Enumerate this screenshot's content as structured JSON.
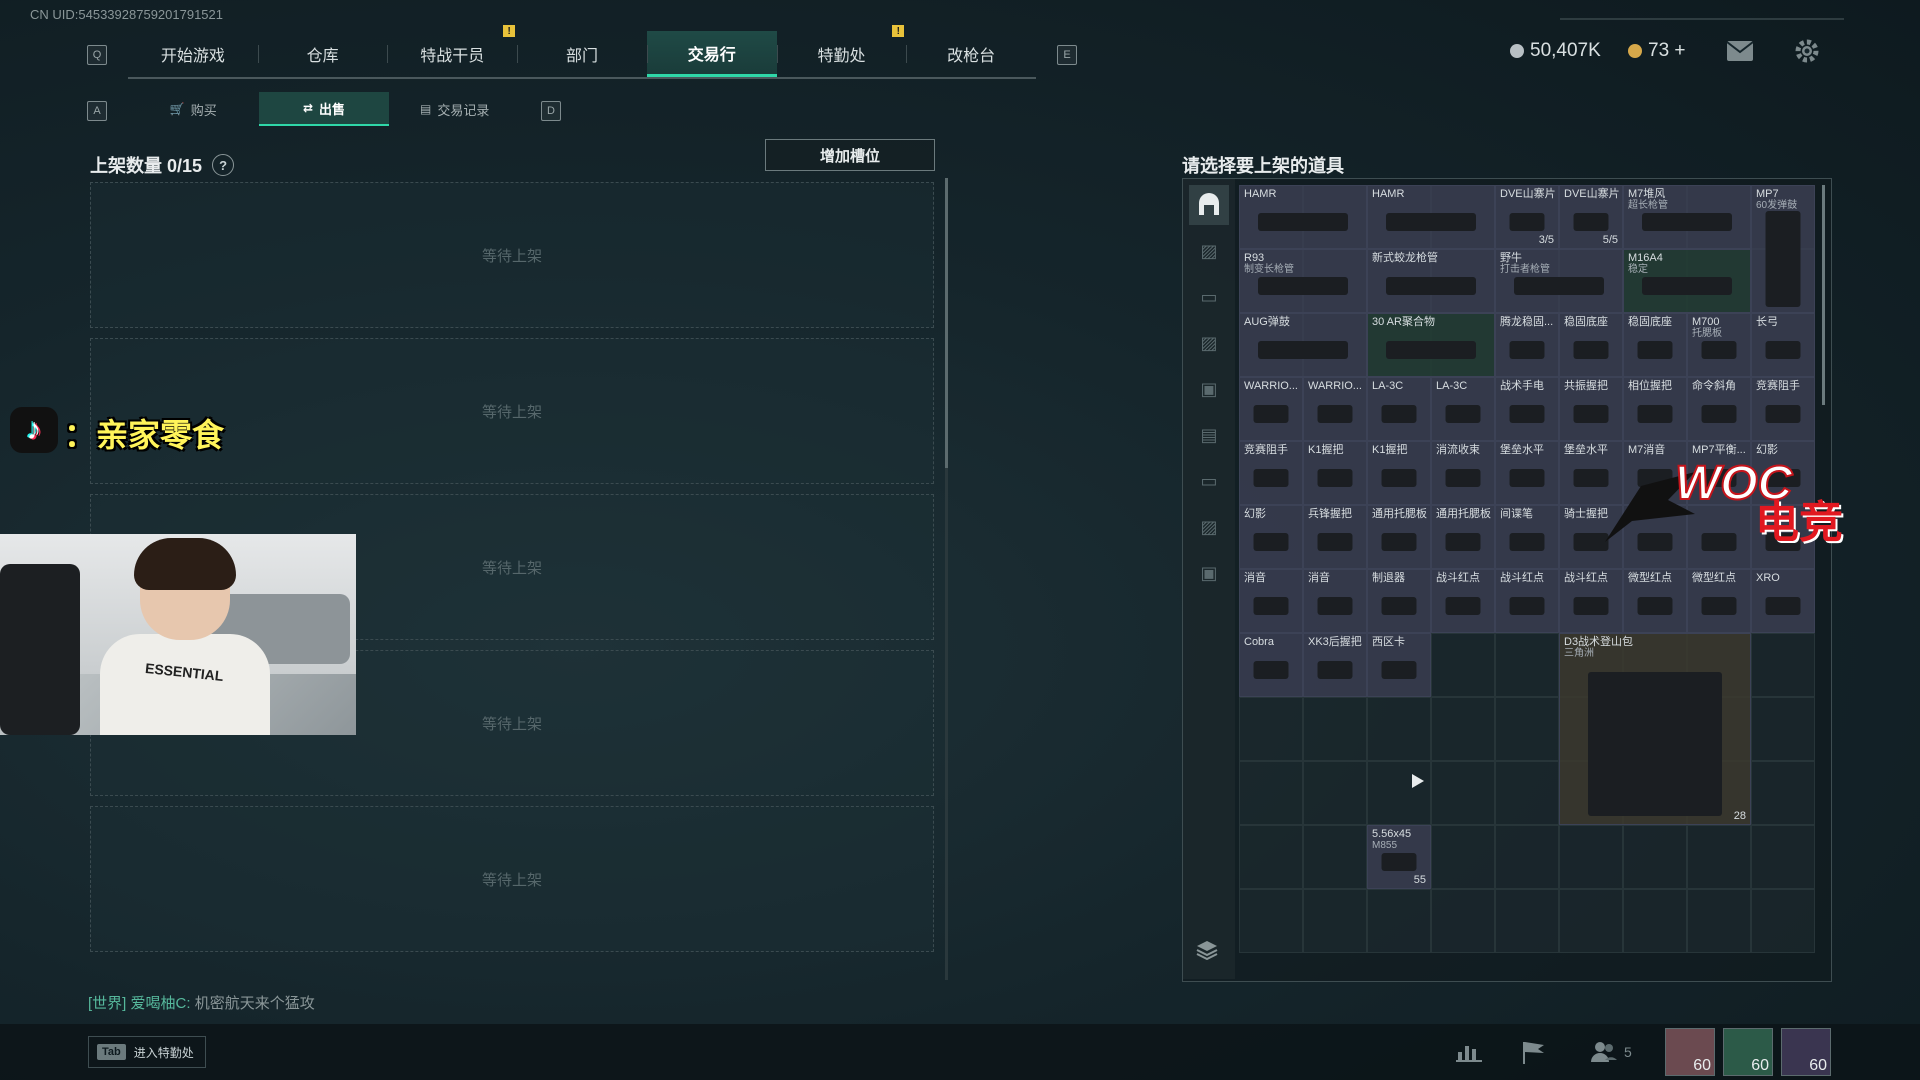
{
  "header": {
    "uid": "CN UID:545339287592017915​21",
    "key_left": "Q",
    "key_right": "E",
    "nav": [
      {
        "label": "开始游戏",
        "active": false,
        "pip": ""
      },
      {
        "label": "仓库",
        "active": false,
        "pip": ""
      },
      {
        "label": "特战干员",
        "active": false,
        "pip": "!"
      },
      {
        "label": "部门",
        "active": false,
        "pip": ""
      },
      {
        "label": "交易行",
        "active": true,
        "pip": ""
      },
      {
        "label": "特勤处",
        "active": false,
        "pip": "!"
      },
      {
        "label": "改枪台",
        "active": false,
        "pip": ""
      }
    ],
    "currency_1": "50,407K",
    "currency_2": "73 +",
    "currency_1_color": "#b8c0c4",
    "currency_2_color": "#d6a84a"
  },
  "subnav": {
    "key_left": "A",
    "key_right": "D",
    "tabs": [
      {
        "label": "购买",
        "icon": "cart-icon",
        "active": false
      },
      {
        "label": "出售",
        "icon": "sell-icon",
        "active": true
      },
      {
        "label": "交易记录",
        "icon": "record-icon",
        "active": false
      }
    ]
  },
  "listing": {
    "title": "上架数量 0/15",
    "help": "?",
    "add_slot": "增加槽位",
    "slots": [
      "等待上架",
      "等待上架",
      "等待上架",
      "等待上架",
      "等待上架"
    ]
  },
  "chat": {
    "channel": "[世界]",
    "user": "爱喝柚C:",
    "message": "机密航天来个猛攻"
  },
  "inventory": {
    "title": "请选择要上架的道具",
    "items": [
      {
        "n": "HAMR",
        "s": "",
        "c": "",
        "col": 1,
        "row": 1,
        "w": 2,
        "h": 1,
        "t": ""
      },
      {
        "n": "HAMR",
        "s": "",
        "c": "",
        "col": 3,
        "row": 1,
        "w": 2,
        "h": 1,
        "t": ""
      },
      {
        "n": "DVE山寨片",
        "s": "",
        "c": "3/5",
        "col": 5,
        "row": 1,
        "w": 1,
        "h": 1,
        "t": ""
      },
      {
        "n": "DVE山寨片",
        "s": "",
        "c": "5/5",
        "col": 6,
        "row": 1,
        "w": 1,
        "h": 1,
        "t": ""
      },
      {
        "n": "M7堆风",
        "s": "超长枪管",
        "c": "",
        "col": 7,
        "row": 1,
        "w": 2,
        "h": 1,
        "t": ""
      },
      {
        "n": "MP7",
        "s": "60发弹鼓",
        "c": "",
        "col": 9,
        "row": 1,
        "w": 1,
        "h": 2,
        "t": ""
      },
      {
        "n": "R93",
        "s": "制变长枪管",
        "c": "",
        "col": 1,
        "row": 2,
        "w": 2,
        "h": 1,
        "t": ""
      },
      {
        "n": "新式蛟龙枪管",
        "s": "",
        "c": "",
        "col": 3,
        "row": 2,
        "w": 2,
        "h": 1,
        "t": ""
      },
      {
        "n": "野牛",
        "s": "打击者枪管",
        "c": "",
        "col": 5,
        "row": 2,
        "w": 2,
        "h": 1,
        "t": ""
      },
      {
        "n": "M16A4",
        "s": "稳定",
        "c": "",
        "col": 7,
        "row": 2,
        "w": 2,
        "h": 1,
        "t": "green"
      },
      {
        "n": "AUG弹鼓",
        "s": "",
        "c": "",
        "col": 1,
        "row": 3,
        "w": 2,
        "h": 1,
        "t": ""
      },
      {
        "n": "30 AR聚合物",
        "s": "",
        "c": "",
        "col": 3,
        "row": 3,
        "w": 2,
        "h": 1,
        "t": "green"
      },
      {
        "n": "腾龙稳固...",
        "s": "",
        "c": "",
        "col": 5,
        "row": 3,
        "w": 1,
        "h": 1,
        "t": ""
      },
      {
        "n": "稳固底座",
        "s": "",
        "c": "",
        "col": 6,
        "row": 3,
        "w": 1,
        "h": 1,
        "t": ""
      },
      {
        "n": "稳固底座",
        "s": "",
        "c": "",
        "col": 7,
        "row": 3,
        "w": 1,
        "h": 1,
        "t": ""
      },
      {
        "n": "M700",
        "s": "托腮板",
        "c": "",
        "col": 8,
        "row": 3,
        "w": 1,
        "h": 1,
        "t": ""
      },
      {
        "n": "长弓",
        "s": "",
        "c": "",
        "col": 9,
        "row": 3,
        "w": 1,
        "h": 1,
        "t": ""
      },
      {
        "n": "WARRIO...",
        "s": "",
        "c": "",
        "col": 1,
        "row": 4,
        "w": 1,
        "h": 1,
        "t": ""
      },
      {
        "n": "WARRIO...",
        "s": "",
        "c": "",
        "col": 2,
        "row": 4,
        "w": 1,
        "h": 1,
        "t": ""
      },
      {
        "n": "LA-3C",
        "s": "",
        "c": "",
        "col": 3,
        "row": 4,
        "w": 1,
        "h": 1,
        "t": ""
      },
      {
        "n": "LA-3C",
        "s": "",
        "c": "",
        "col": 4,
        "row": 4,
        "w": 1,
        "h": 1,
        "t": ""
      },
      {
        "n": "战术手电",
        "s": "",
        "c": "",
        "col": 5,
        "row": 4,
        "w": 1,
        "h": 1,
        "t": ""
      },
      {
        "n": "共振握把",
        "s": "",
        "c": "",
        "col": 6,
        "row": 4,
        "w": 1,
        "h": 1,
        "t": ""
      },
      {
        "n": "相位握把",
        "s": "",
        "c": "",
        "col": 7,
        "row": 4,
        "w": 1,
        "h": 1,
        "t": ""
      },
      {
        "n": "命令斜角",
        "s": "",
        "c": "",
        "col": 8,
        "row": 4,
        "w": 1,
        "h": 1,
        "t": ""
      },
      {
        "n": "竞赛阻手",
        "s": "",
        "c": "",
        "col": 9,
        "row": 4,
        "w": 1,
        "h": 1,
        "t": ""
      },
      {
        "n": "竞赛阻手",
        "s": "",
        "c": "",
        "col": 1,
        "row": 5,
        "w": 1,
        "h": 1,
        "t": ""
      },
      {
        "n": "K1握把",
        "s": "",
        "c": "",
        "col": 2,
        "row": 5,
        "w": 1,
        "h": 1,
        "t": ""
      },
      {
        "n": "K1握把",
        "s": "",
        "c": "",
        "col": 3,
        "row": 5,
        "w": 1,
        "h": 1,
        "t": ""
      },
      {
        "n": "消流收束",
        "s": "",
        "c": "",
        "col": 4,
        "row": 5,
        "w": 1,
        "h": 1,
        "t": ""
      },
      {
        "n": "堡垒水平",
        "s": "",
        "c": "",
        "col": 5,
        "row": 5,
        "w": 1,
        "h": 1,
        "t": ""
      },
      {
        "n": "堡垒水平",
        "s": "",
        "c": "",
        "col": 6,
        "row": 5,
        "w": 1,
        "h": 1,
        "t": ""
      },
      {
        "n": "M7消音",
        "s": "",
        "c": "",
        "col": 7,
        "row": 5,
        "w": 1,
        "h": 1,
        "t": ""
      },
      {
        "n": "MP7平衡...",
        "s": "",
        "c": "",
        "col": 8,
        "row": 5,
        "w": 1,
        "h": 1,
        "t": ""
      },
      {
        "n": "幻影",
        "s": "",
        "c": "",
        "col": 9,
        "row": 5,
        "w": 1,
        "h": 1,
        "t": ""
      },
      {
        "n": "幻影",
        "s": "",
        "c": "",
        "col": 1,
        "row": 6,
        "w": 1,
        "h": 1,
        "t": ""
      },
      {
        "n": "兵锋握把",
        "s": "",
        "c": "",
        "col": 2,
        "row": 6,
        "w": 1,
        "h": 1,
        "t": ""
      },
      {
        "n": "通用托腮板",
        "s": "",
        "c": "",
        "col": 3,
        "row": 6,
        "w": 1,
        "h": 1,
        "t": ""
      },
      {
        "n": "通用托腮板",
        "s": "",
        "c": "",
        "col": 4,
        "row": 6,
        "w": 1,
        "h": 1,
        "t": ""
      },
      {
        "n": "间谍笔",
        "s": "",
        "c": "",
        "col": 5,
        "row": 6,
        "w": 1,
        "h": 1,
        "t": ""
      },
      {
        "n": "骑士握把",
        "s": "",
        "c": "",
        "col": 6,
        "row": 6,
        "w": 1,
        "h": 1,
        "t": ""
      },
      {
        "n": "",
        "s": "",
        "c": "",
        "col": 7,
        "row": 6,
        "w": 1,
        "h": 1,
        "t": ""
      },
      {
        "n": "",
        "s": "",
        "c": "",
        "col": 8,
        "row": 6,
        "w": 1,
        "h": 1,
        "t": ""
      },
      {
        "n": "",
        "s": "",
        "c": "",
        "col": 9,
        "row": 6,
        "w": 1,
        "h": 1,
        "t": ""
      },
      {
        "n": "消音",
        "s": "",
        "c": "",
        "col": 1,
        "row": 7,
        "w": 1,
        "h": 1,
        "t": ""
      },
      {
        "n": "消音",
        "s": "",
        "c": "",
        "col": 2,
        "row": 7,
        "w": 1,
        "h": 1,
        "t": ""
      },
      {
        "n": "制退器",
        "s": "",
        "c": "",
        "col": 3,
        "row": 7,
        "w": 1,
        "h": 1,
        "t": ""
      },
      {
        "n": "战斗红点",
        "s": "",
        "c": "",
        "col": 4,
        "row": 7,
        "w": 1,
        "h": 1,
        "t": ""
      },
      {
        "n": "战斗红点",
        "s": "",
        "c": "",
        "col": 5,
        "row": 7,
        "w": 1,
        "h": 1,
        "t": ""
      },
      {
        "n": "战斗红点",
        "s": "",
        "c": "",
        "col": 6,
        "row": 7,
        "w": 1,
        "h": 1,
        "t": ""
      },
      {
        "n": "微型红点",
        "s": "",
        "c": "",
        "col": 7,
        "row": 7,
        "w": 1,
        "h": 1,
        "t": ""
      },
      {
        "n": "微型红点",
        "s": "",
        "c": "",
        "col": 8,
        "row": 7,
        "w": 1,
        "h": 1,
        "t": ""
      },
      {
        "n": "XRO",
        "s": "",
        "c": "",
        "col": 9,
        "row": 7,
        "w": 1,
        "h": 1,
        "t": ""
      },
      {
        "n": "Cobra",
        "s": "",
        "c": "",
        "col": 1,
        "row": 8,
        "w": 1,
        "h": 1,
        "t": ""
      },
      {
        "n": "XK3后握把",
        "s": "",
        "c": "",
        "col": 2,
        "row": 8,
        "w": 1,
        "h": 1,
        "t": ""
      },
      {
        "n": "西区卡",
        "s": "",
        "c": "",
        "col": 3,
        "row": 8,
        "w": 1,
        "h": 1,
        "t": ""
      },
      {
        "n": "D3战术登山包",
        "s": "三角洲",
        "c": "28",
        "col": 6,
        "row": 8,
        "w": 3,
        "h": 3,
        "t": "brown"
      },
      {
        "n": "5.56x45",
        "s": "M855",
        "c": "55",
        "col": 3,
        "row": 11,
        "w": 1,
        "h": 1,
        "t": ""
      }
    ]
  },
  "bottom": {
    "tab_key": "Tab",
    "tab_label": "进入特勤处",
    "team_count": "5",
    "avatars": [
      {
        "level": "60",
        "color": "#6b4a50"
      },
      {
        "level": "60",
        "color": "#2c5a48"
      },
      {
        "level": "60",
        "color": "#3a3550"
      }
    ]
  },
  "overlay": {
    "tiktok_name": "：亲家零食",
    "watermark_latin": "WOC",
    "watermark_cn": "电竞",
    "webcam_shirt": "ESSENTIAL"
  }
}
